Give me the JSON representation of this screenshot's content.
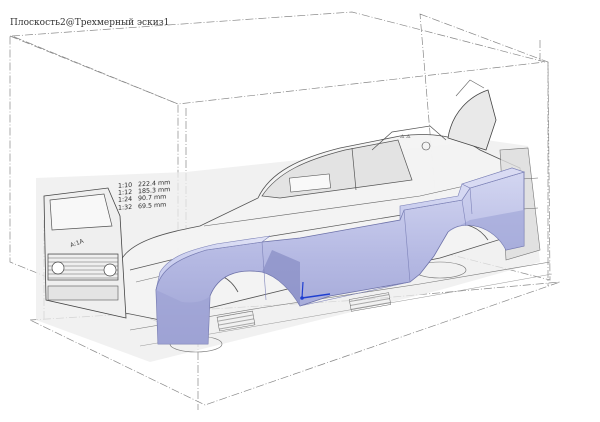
{
  "viewport": {
    "sketch_label": "Плоскость2@Трехмерный эскиз1",
    "scale_table": [
      {
        "scale": "1:10",
        "value": "222.4 mm"
      },
      {
        "scale": "1:12",
        "value": "185.3 mm"
      },
      {
        "scale": "1:24",
        "value": "90.7 mm"
      },
      {
        "scale": "1:32",
        "value": "69.5 mm"
      }
    ],
    "plate_text": "A:1A",
    "colors": {
      "background": "#ffffff",
      "body_fill": "#b9bde6",
      "body_shade": "#9a9fd0",
      "body_light": "#d6d9f2",
      "plane_border": "#7a7a7a",
      "blueprint_line": "#4a4a4a",
      "axis_blue": "#1f3fd0"
    },
    "icons": [
      "plane-border-icon",
      "triad-icon"
    ]
  }
}
